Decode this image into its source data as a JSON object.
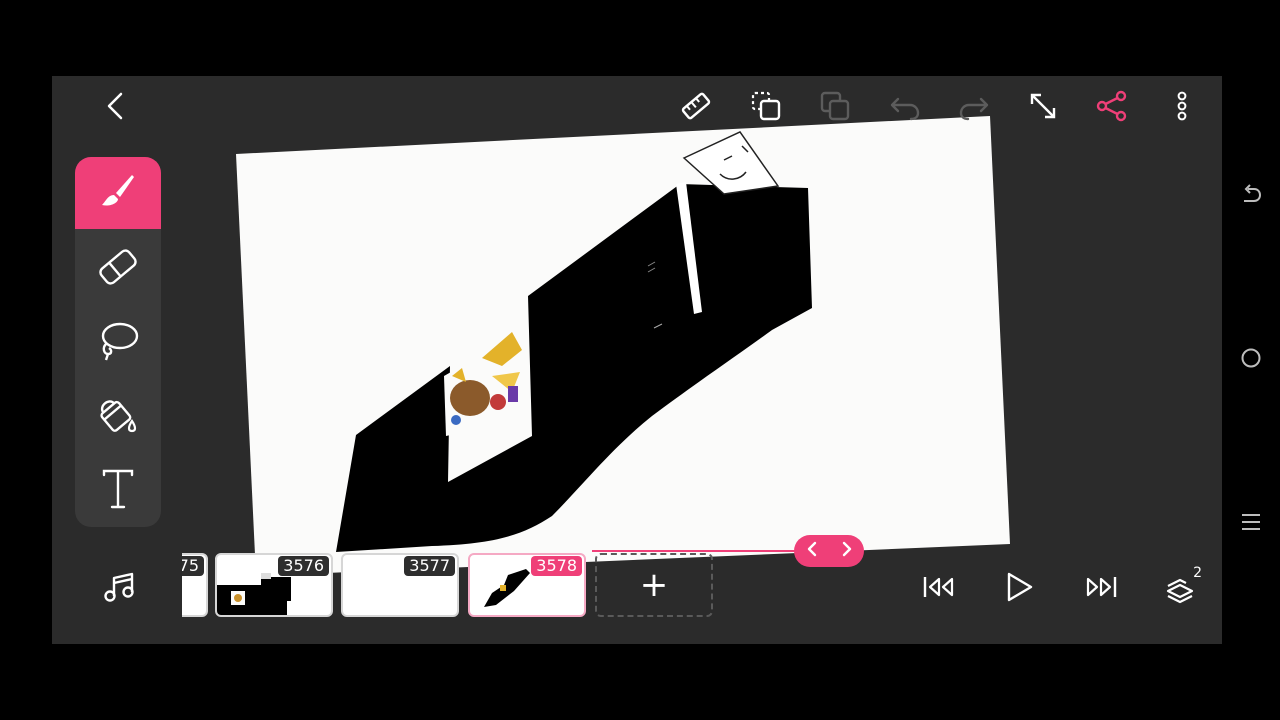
{
  "colors": {
    "accent": "#ef3f78",
    "app_background": "#2b2b2b",
    "panel_background": "#3a3a3a",
    "icon": "#ffffff",
    "icon_disabled": "#5c5c5c",
    "canvas_paper": "#fbfbfa"
  },
  "toolbar": {
    "icons": [
      "back-icon",
      "ruler-icon",
      "copy-frame-icon",
      "paste-frame-icon",
      "undo-icon",
      "redo-icon",
      "fullscreen-icon",
      "share-icon",
      "more-icon"
    ]
  },
  "tools": {
    "items": [
      "brush-icon",
      "eraser-icon",
      "lasso-icon",
      "fill-bucket-icon",
      "text-icon"
    ],
    "active": "brush-icon"
  },
  "timeline": {
    "frames": [
      {
        "number": "75"
      },
      {
        "number": "3576"
      },
      {
        "number": "3577"
      },
      {
        "number": "3578"
      }
    ],
    "active_frame": "3578",
    "add_label": "+"
  },
  "playback": {
    "icons": [
      "music-icon",
      "skip-to-start-icon",
      "play-icon",
      "skip-to-end-icon",
      "layers-icon"
    ],
    "layers_count": "2"
  },
  "system_nav": {
    "icons": [
      "rotate-icon",
      "home-icon",
      "recents-icon"
    ]
  }
}
